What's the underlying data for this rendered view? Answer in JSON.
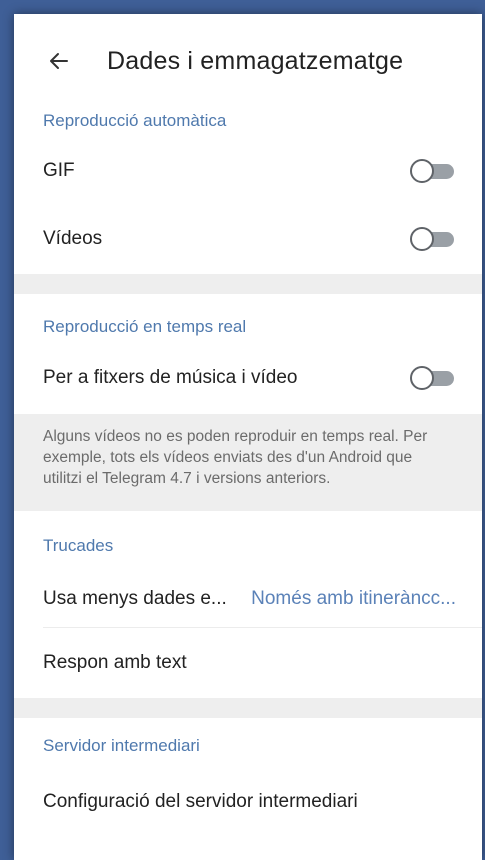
{
  "header": {
    "title": "Dades i emmagatzematge",
    "back_icon": "arrow-left-icon"
  },
  "sections": {
    "autoplay": {
      "header": "Reproducció automàtica",
      "gif_label": "GIF",
      "gif_enabled": false,
      "videos_label": "Vídeos",
      "videos_enabled": false
    },
    "streaming": {
      "header": "Reproducció en temps real",
      "music_video_label": "Per a fitxers de música i vídeo",
      "music_video_enabled": false,
      "info": "Alguns vídeos no es poden reproduir en temps real. Per exemple, tots els vídeos enviats des d'un Android que utilitzi el Telegram 4.7 i versions anteriors."
    },
    "calls": {
      "header": "Trucades",
      "less_data_label": "Usa menys dades e...",
      "less_data_value": "Només amb itineràncc...",
      "respond_text_label": "Respon amb text"
    },
    "proxy": {
      "header": "Servidor intermediari",
      "settings_label": "Configuració del servidor intermediari"
    }
  },
  "colors": {
    "accent": "#4f79ad",
    "background_outer": "#3f5f97",
    "section_gap": "#eeeeee"
  }
}
